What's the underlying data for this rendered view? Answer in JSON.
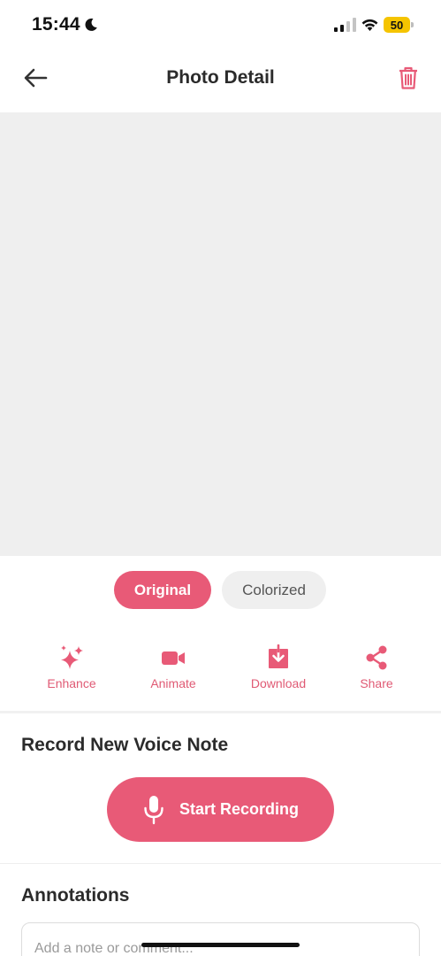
{
  "status_bar": {
    "time": "15:44",
    "battery": "50"
  },
  "header": {
    "title": "Photo Detail",
    "back_icon": "arrow-left-icon",
    "delete_icon": "trash-icon"
  },
  "toggle": {
    "original_label": "Original",
    "colorized_label": "Colorized",
    "selected": "Original"
  },
  "actions": [
    {
      "label": "Enhance",
      "icon": "sparkles-icon"
    },
    {
      "label": "Animate",
      "icon": "video-camera-icon"
    },
    {
      "label": "Download",
      "icon": "download-icon"
    },
    {
      "label": "Share",
      "icon": "share-icon"
    }
  ],
  "voice": {
    "title": "Record New Voice Note",
    "record_label": "Start Recording",
    "icon": "microphone-icon"
  },
  "annotations": {
    "title": "Annotations",
    "placeholder": "Add a note or comment..."
  },
  "colors": {
    "accent": "#e85a77",
    "accent_text": "#e05a74",
    "photo_bg": "#efefef",
    "battery": "#f5c400"
  }
}
